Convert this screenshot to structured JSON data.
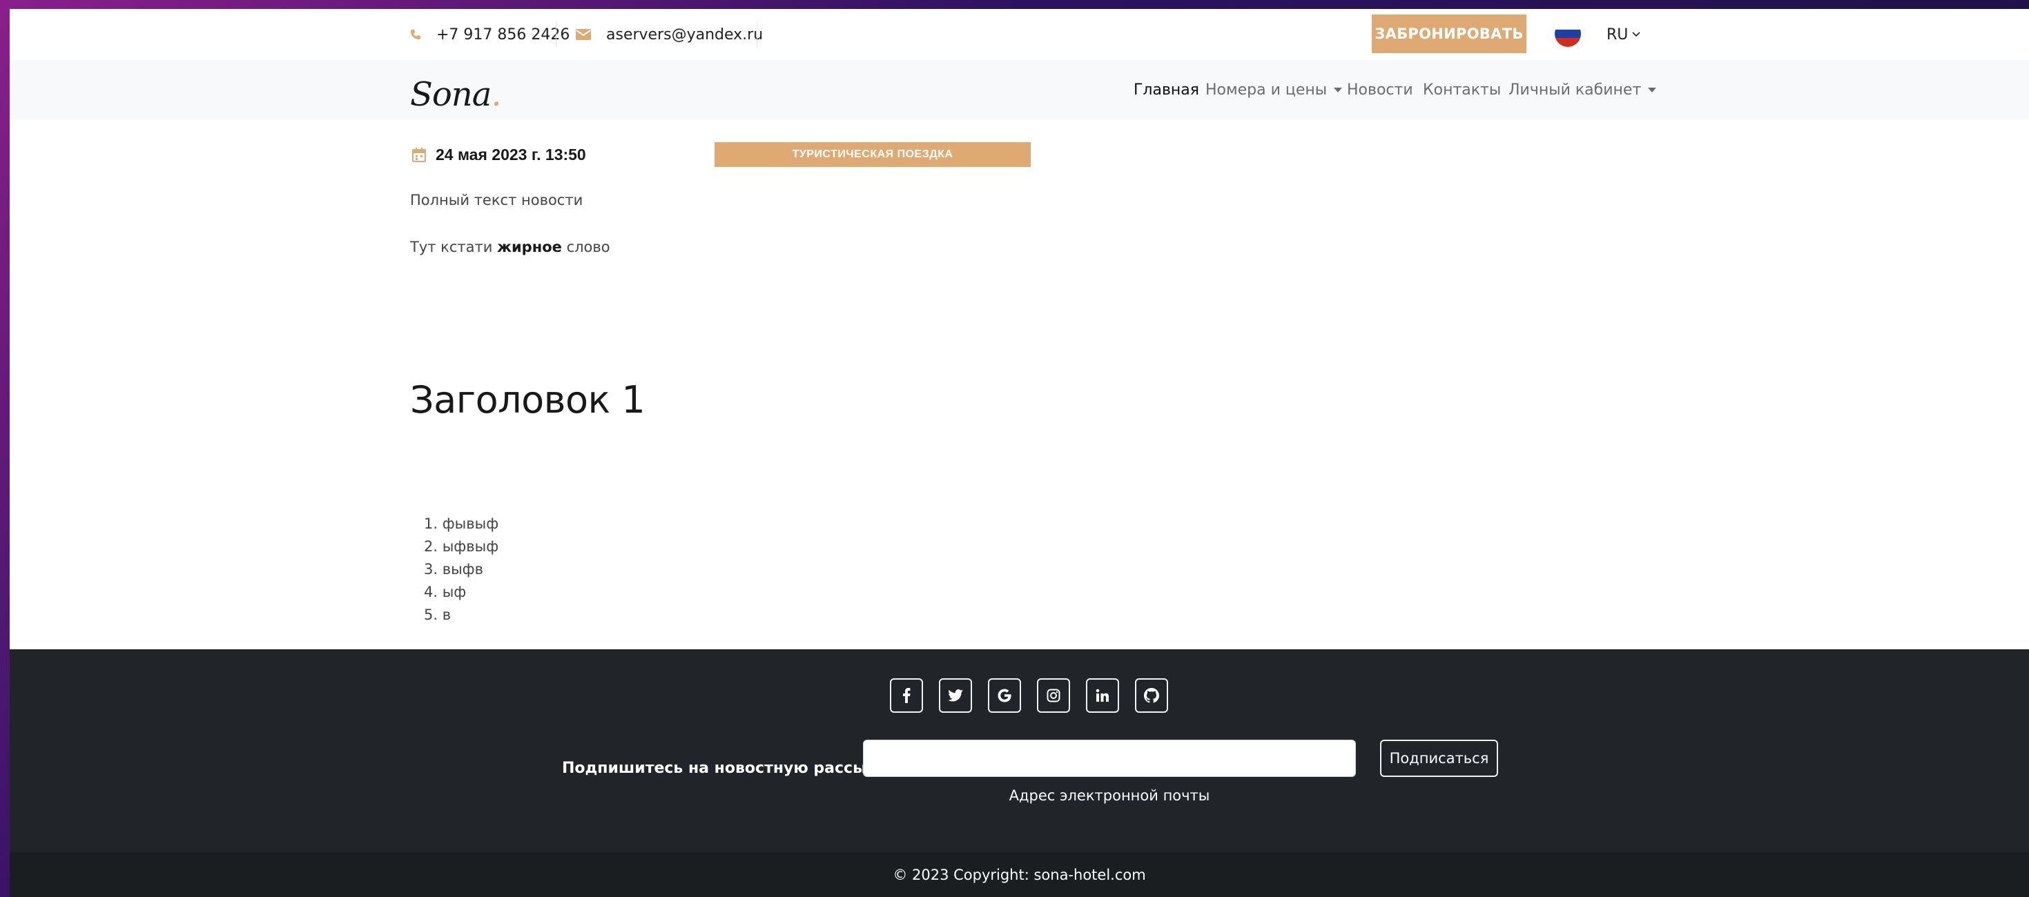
{
  "topbar": {
    "phone": "+7 917 856 2426",
    "email": "aservers@yandex.ru",
    "book_label": "ЗАБРОНИРОВАТЬ",
    "lang": "RU"
  },
  "nav": {
    "logo": "Sona",
    "logo_dot": ".",
    "items": [
      "Главная",
      "Номера и цены",
      "Новости",
      "Контакты",
      "Личный кабинет"
    ]
  },
  "article": {
    "date": "24 мая 2023 г. 13:50",
    "category": "ТУРИСТИЧЕСКАЯ ПОЕЗДКА",
    "paragraph1": "Полный текст новости",
    "p2_before": "Тут кстати ",
    "p2_bold": "жирное",
    "p2_after": " слово",
    "heading": "Заголовок 1",
    "list": [
      "1. фывыф",
      "2. ыфвыф",
      "3. выфв",
      "4. ыф",
      "5. в"
    ]
  },
  "footer": {
    "socials": [
      "facebook-icon",
      "twitter-icon",
      "google-icon",
      "instagram-icon",
      "linkedin-icon",
      "github-icon"
    ],
    "subscribe_label": "Подпишитесь на новостную рассылку",
    "email_help": "Адрес электронной почты",
    "subscribe_button": "Подписаться",
    "copyright": "© 2023 Copyright: sona-hotel.com"
  },
  "colors": {
    "accent": "#dfa974",
    "footer_bg": "#212529",
    "navbar_bg": "#f8f9fa"
  }
}
